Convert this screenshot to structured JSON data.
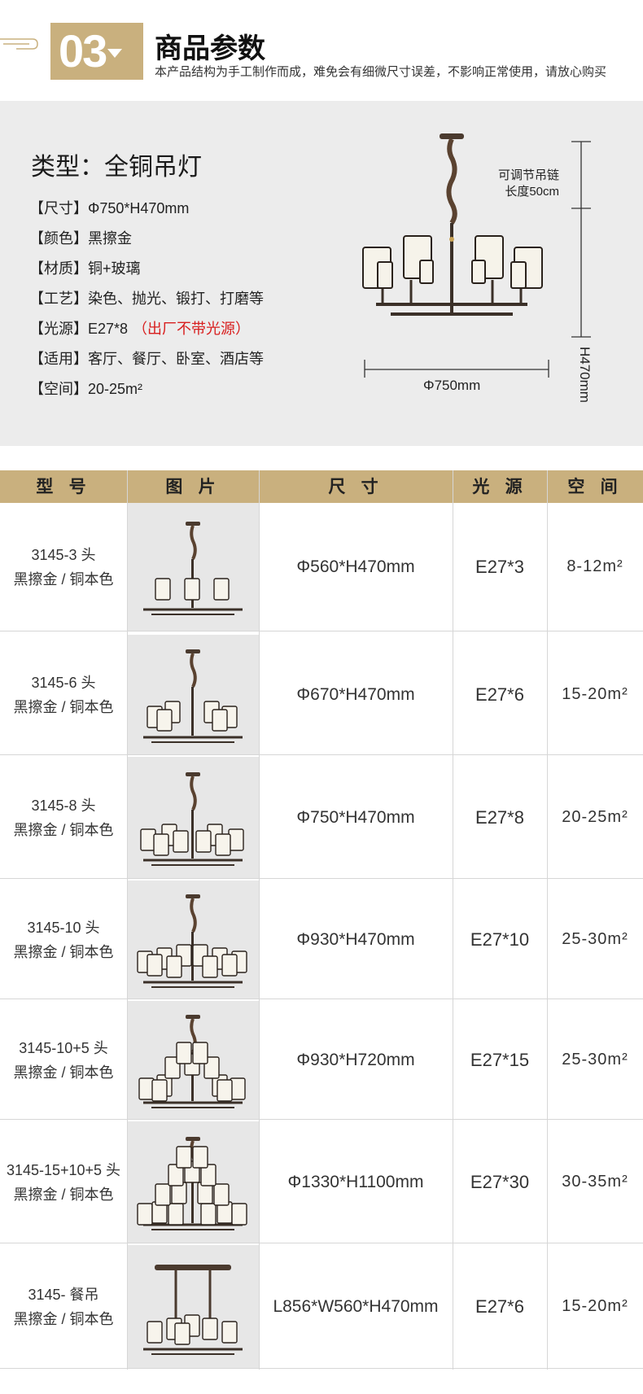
{
  "header": {
    "number": "03",
    "title": "商品参数",
    "subtitle": "本产品结构为手工制作而成，难免会有细微尺寸误差，不影响正常使用，请放心购买"
  },
  "spec": {
    "type_line": "类型：全铜吊灯",
    "rows": [
      {
        "label": "【尺寸】",
        "value": "Φ750*H470mm",
        "note": ""
      },
      {
        "label": "【颜色】",
        "value": "黑擦金",
        "note": ""
      },
      {
        "label": "【材质】",
        "value": "铜+玻璃",
        "note": ""
      },
      {
        "label": "【工艺】",
        "value": "染色、抛光、锻打、打磨等",
        "note": ""
      },
      {
        "label": "【光源】",
        "value": "E27*8",
        "note": "（出厂不带光源）"
      },
      {
        "label": "【适用】",
        "value": "客厅、餐厅、卧室、酒店等",
        "note": ""
      },
      {
        "label": "【空间】",
        "value": "20-25m²",
        "note": ""
      }
    ],
    "chain_note_1": "可调节吊链",
    "chain_note_2": "长度50cm",
    "dim_height": "H470mm",
    "dim_width": "Φ750mm"
  },
  "table": {
    "headers": [
      "型 号",
      "图 片",
      "尺 寸",
      "光 源",
      "空 间"
    ],
    "rows": [
      {
        "model": "3145-3 头",
        "color": "黑擦金 / 铜本色",
        "size": "Φ560*H470mm",
        "light": "E27*3",
        "space": "8-12m²"
      },
      {
        "model": "3145-6 头",
        "color": "黑擦金 / 铜本色",
        "size": "Φ670*H470mm",
        "light": "E27*6",
        "space": "15-20m²"
      },
      {
        "model": "3145-8 头",
        "color": "黑擦金 / 铜本色",
        "size": "Φ750*H470mm",
        "light": "E27*8",
        "space": "20-25m²"
      },
      {
        "model": "3145-10 头",
        "color": "黑擦金 / 铜本色",
        "size": "Φ930*H470mm",
        "light": "E27*10",
        "space": "25-30m²"
      },
      {
        "model": "3145-10+5 头",
        "color": "黑擦金 / 铜本色",
        "size": "Φ930*H720mm",
        "light": "E27*15",
        "space": "25-30m²"
      },
      {
        "model": "3145-15+10+5 头",
        "color": "黑擦金 / 铜本色",
        "size": "Φ1330*H1100mm",
        "light": "E27*30",
        "space": "30-35m²"
      },
      {
        "model": "3145- 餐吊",
        "color": "黑擦金 / 铜本色",
        "size": "L856*W560*H470mm",
        "light": "E27*6",
        "space": "15-20m²"
      }
    ]
  }
}
